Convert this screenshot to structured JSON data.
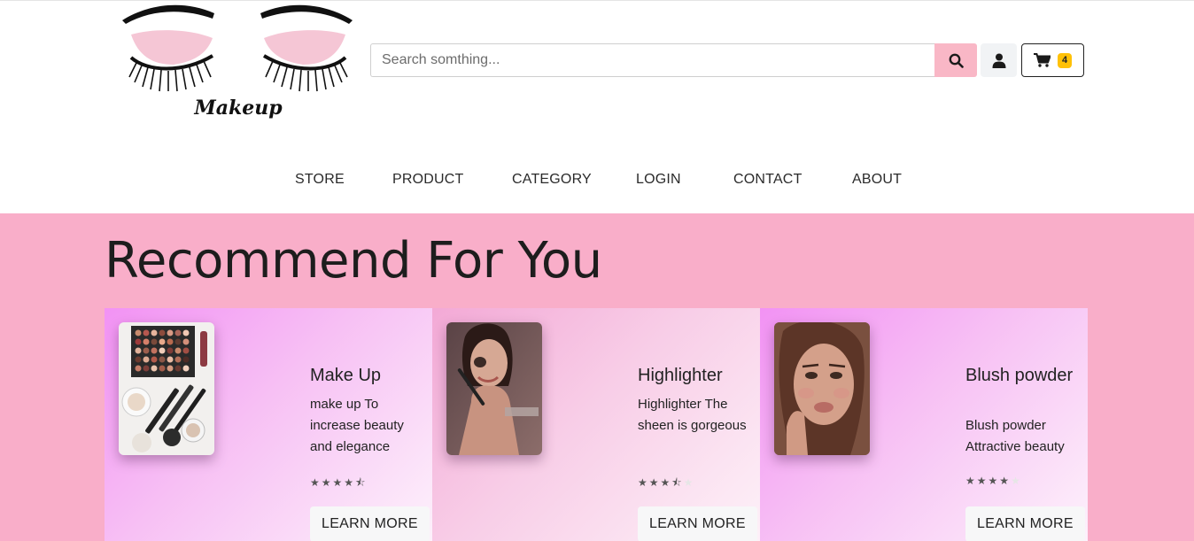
{
  "header": {
    "logo_text": "Makeup",
    "search": {
      "placeholder": "Search somthing...",
      "value": ""
    },
    "cart_count": "4"
  },
  "nav": {
    "items": [
      {
        "label": "STORE"
      },
      {
        "label": "PRODUCT"
      },
      {
        "label": "CATEGORY"
      },
      {
        "label": "LOGIN"
      },
      {
        "label": "CONTACT"
      },
      {
        "label": "ABOUT"
      }
    ]
  },
  "hero": {
    "title": "Recommend For You",
    "cards": [
      {
        "title": "Make Up",
        "desc": "make up To increase beauty and elegance",
        "rating": 4.5,
        "button": "LEARN MORE"
      },
      {
        "title": "Highlighter",
        "desc": "Highlighter The sheen is gorgeous",
        "rating": 3.5,
        "button": "LEARN MORE"
      },
      {
        "title": "Blush powder",
        "desc": "Blush powder Attractive beauty",
        "rating": 4,
        "button": "LEARN MORE"
      }
    ]
  },
  "colors": {
    "hero_bg": "#f9aec9",
    "search_button": "#f9b7c6",
    "cart_badge": "#ffc107"
  },
  "icons": [
    "search-icon",
    "user-icon",
    "cart-icon",
    "star-icon"
  ]
}
